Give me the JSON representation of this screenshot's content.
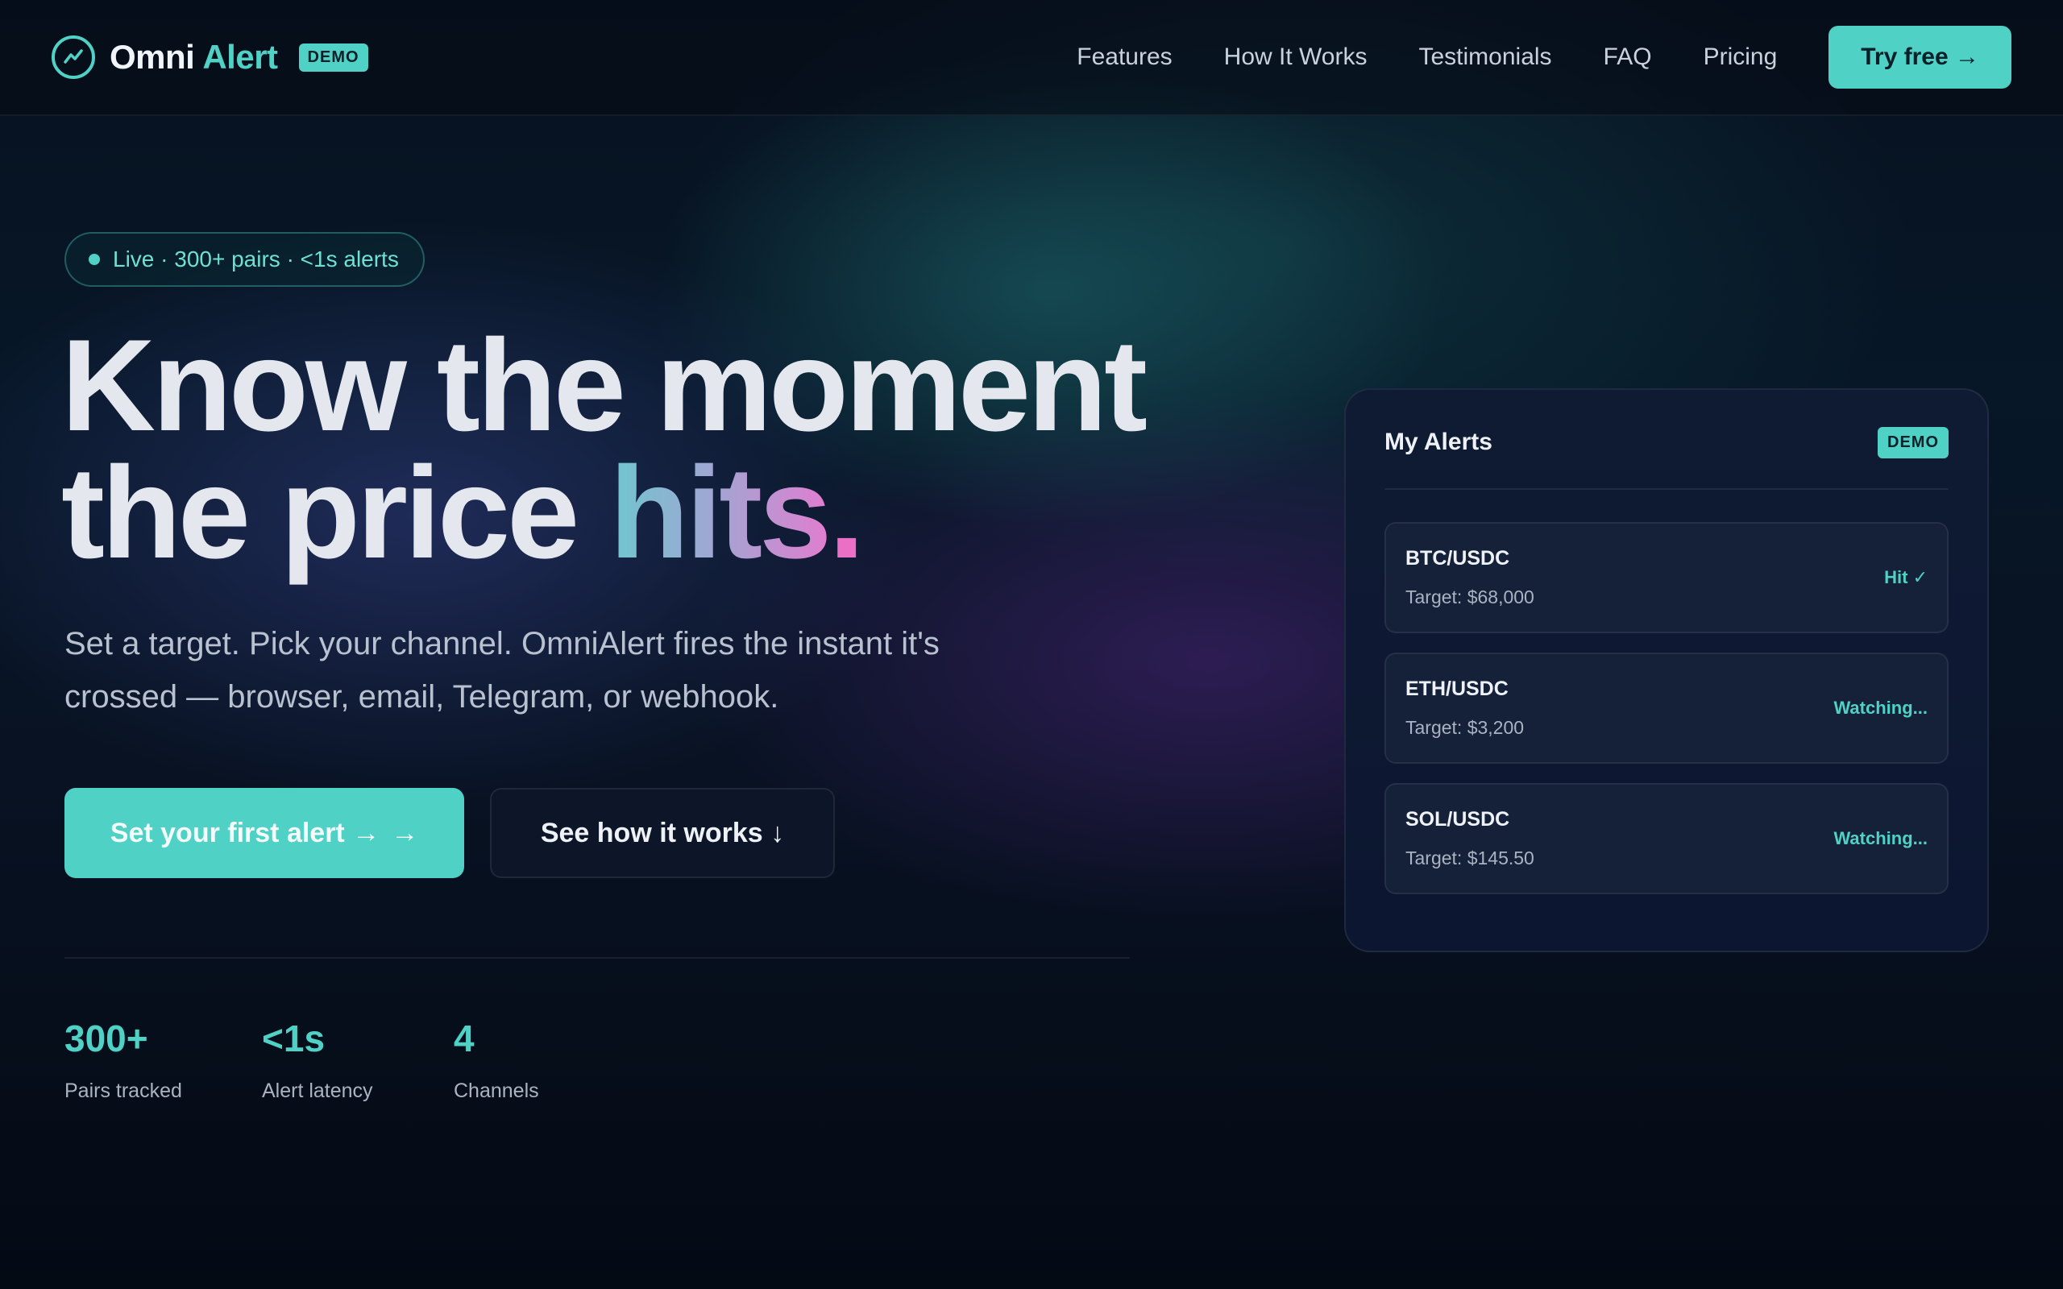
{
  "brand": {
    "name_a": "Omni",
    "name_b": "Alert",
    "badge": "DEMO"
  },
  "nav": {
    "links": [
      "Features",
      "How It Works",
      "Testimonials",
      "FAQ",
      "Pricing"
    ],
    "cta": "Try free →"
  },
  "hero": {
    "pill": "Live · 300+ pairs · <1s alerts",
    "headline_line1": "Know the moment",
    "headline_line2_a": "the price ",
    "headline_line2_b": "hits",
    "headline_line2_c": ".",
    "subtitle": "Set a target. Pick your channel. OmniAlert fires the instant it's crossed — browser, email, Telegram, or webhook.",
    "primary_cta": "Set your first alert →",
    "primary_cta_arrow": "→",
    "secondary_cta": "See how it works ↓"
  },
  "stats": [
    {
      "value": "300+",
      "label": "Pairs tracked"
    },
    {
      "value": "<1s",
      "label": "Alert latency"
    },
    {
      "value": "4",
      "label": "Channels"
    }
  ],
  "card": {
    "title": "My Alerts",
    "badge": "DEMO",
    "alerts": [
      {
        "pair": "BTC/USDC",
        "target": "Target: $68,000",
        "status": "Hit ✓"
      },
      {
        "pair": "ETH/USDC",
        "target": "Target: $3,200",
        "status": "Watching..."
      },
      {
        "pair": "SOL/USDC",
        "target": "Target: $145.50",
        "status": "Watching..."
      }
    ]
  },
  "colors": {
    "accent": "#4fd1c5",
    "background": "#050b16",
    "gradient_pink": "#e07ed0"
  },
  "icons": {
    "logo": "trend-line-icon"
  }
}
